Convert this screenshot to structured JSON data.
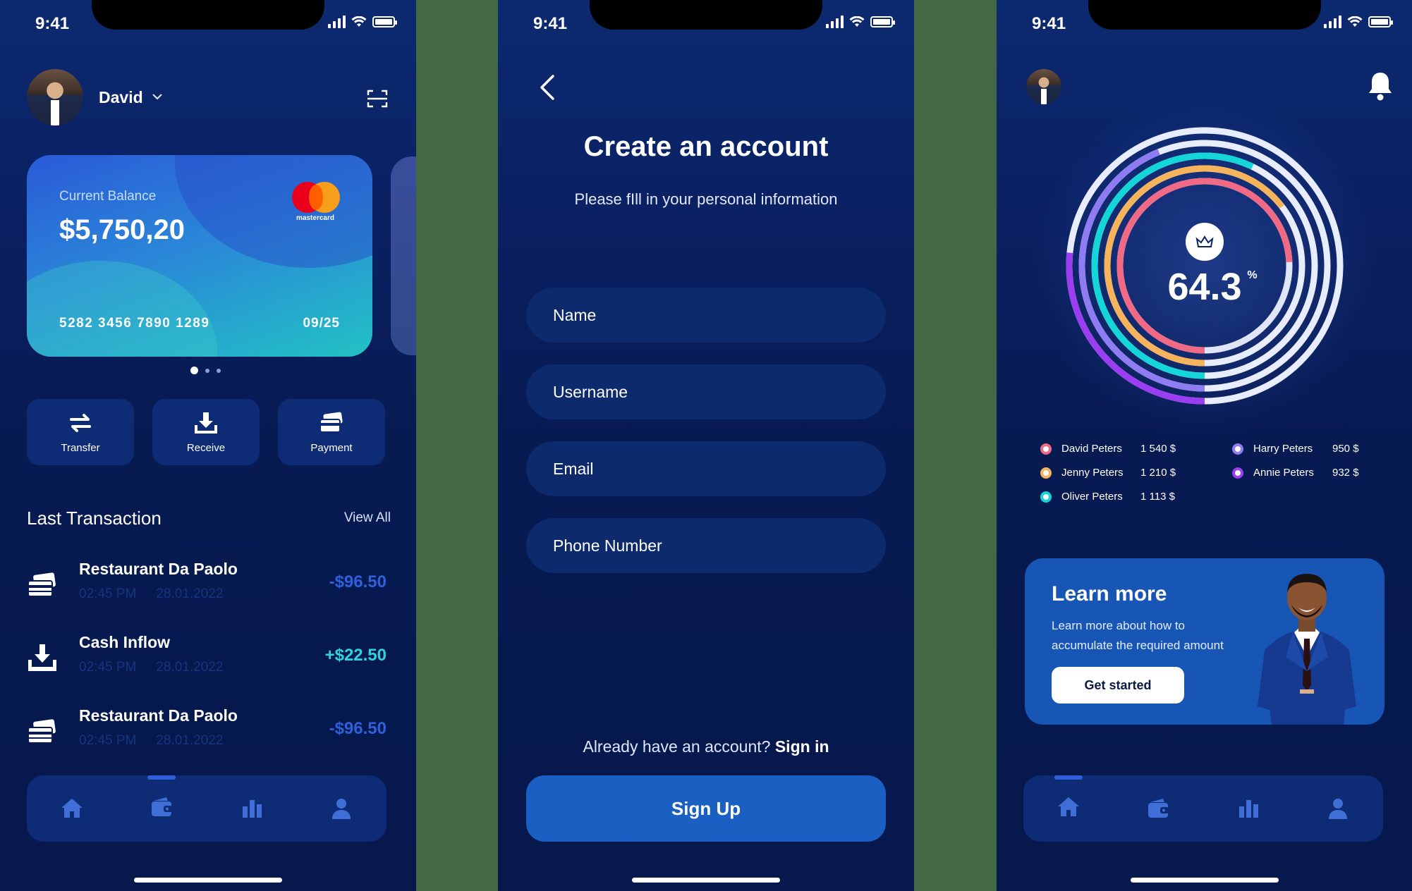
{
  "status": {
    "time": "9:41"
  },
  "wallet": {
    "user_name": "David",
    "card": {
      "label": "Current Balance",
      "balance": "$5,750,20",
      "number": "5282 3456 7890 1289",
      "expiry": "09/25",
      "brand": "mastercard"
    },
    "carousel": {
      "pages": 3,
      "active": 1
    },
    "actions": [
      {
        "label": "Transfer",
        "icon": "transfer-icon"
      },
      {
        "label": "Receive",
        "icon": "receive-icon"
      },
      {
        "label": "Payment",
        "icon": "payment-icon"
      }
    ],
    "section_title": "Last Transaction",
    "view_all": "View All",
    "transactions": [
      {
        "name": "Restaurant Da Paolo",
        "time": "02:45 PM",
        "date": "28.01.2022",
        "amount": "-$96.50",
        "type": "debit",
        "icon": "card-icon"
      },
      {
        "name": "Cash Inflow",
        "time": "02:45 PM",
        "date": "28.01.2022",
        "amount": "+$22.50",
        "type": "credit",
        "icon": "receive-icon"
      },
      {
        "name": "Restaurant Da Paolo",
        "time": "02:45 PM",
        "date": "28.01.2022",
        "amount": "-$96.50",
        "type": "debit",
        "icon": "card-icon"
      }
    ],
    "nav": {
      "active": "wallet",
      "items": [
        "home",
        "wallet",
        "stats",
        "profile"
      ]
    }
  },
  "signup": {
    "title": "Create an account",
    "subtitle": "Please fIll in your personal information",
    "fields": [
      {
        "placeholder": "Name"
      },
      {
        "placeholder": "Username"
      },
      {
        "placeholder": "Email"
      },
      {
        "placeholder": "Phone Number"
      }
    ],
    "signin_prompt": "Already have an account?",
    "signin_link": "Sign in",
    "submit_label": "Sign Up"
  },
  "stats": {
    "percent": "64.3",
    "percent_unit": "%",
    "people": [
      {
        "name": "David Peters",
        "value": "1 540 $",
        "color": "#f06a86"
      },
      {
        "name": "Jenny Peters",
        "value": "1 210 $",
        "color": "#f5b35c"
      },
      {
        "name": "Oliver Peters",
        "value": "1 113 $",
        "color": "#14d6d9"
      },
      {
        "name": "Harry Peters",
        "value": "950 $",
        "color": "#8f7cf2"
      },
      {
        "name": "Annie Peters",
        "value": "932 $",
        "color": "#9b3df0"
      }
    ],
    "learn": {
      "title": "Learn more",
      "description": "Learn more about how to accumulate the required amount",
      "button": "Get started"
    },
    "nav": {
      "active": "home",
      "items": [
        "home",
        "wallet",
        "stats",
        "profile"
      ]
    }
  },
  "colors": {
    "accent": "#1a5fc2",
    "bg": "#071a52",
    "credit": "#31d2e0",
    "debit": "#2f60d9"
  }
}
